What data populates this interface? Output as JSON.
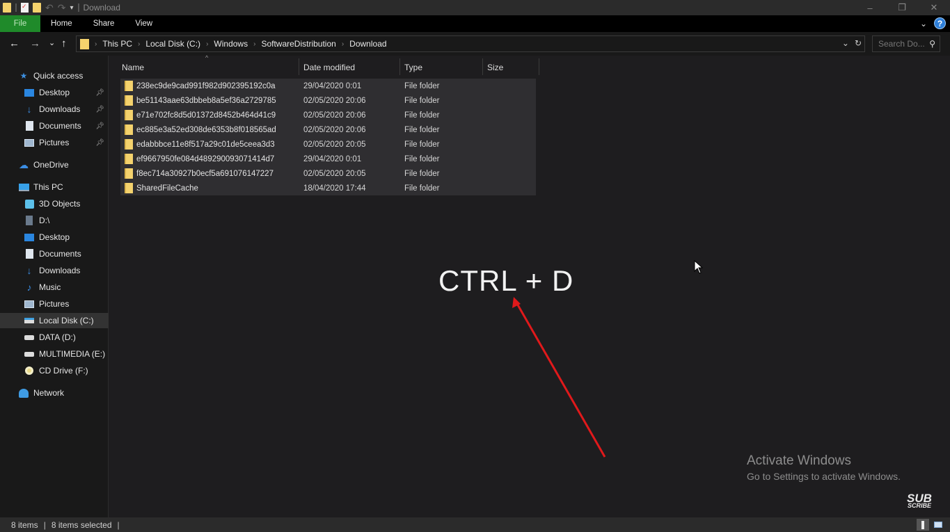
{
  "window": {
    "title": "Download",
    "controls": {
      "minimize": "–",
      "restore": "❐",
      "close": "✕"
    }
  },
  "quick_access_toolbar": {
    "icons": [
      "folder-icon",
      "properties-icon",
      "new-folder-icon",
      "undo-icon",
      "redo-icon",
      "customize-dropdown-icon"
    ]
  },
  "ribbon": {
    "tabs": [
      {
        "label": "File",
        "active": true
      },
      {
        "label": "Home"
      },
      {
        "label": "Share"
      },
      {
        "label": "View"
      }
    ],
    "help_label": "?"
  },
  "navigation": {
    "back": "←",
    "forward": "→",
    "recent": "⌄",
    "up": "↑",
    "breadcrumb": [
      "This PC",
      "Local Disk (C:)",
      "Windows",
      "SoftwareDistribution",
      "Download"
    ],
    "search_placeholder": "Search Do..."
  },
  "sidebar": {
    "items": [
      {
        "label": "Quick access",
        "icon": "star-icon",
        "level": 0
      },
      {
        "label": "Desktop",
        "icon": "desktop-icon",
        "level": 1,
        "pinned": true
      },
      {
        "label": "Downloads",
        "icon": "download-icon",
        "level": 1,
        "pinned": true
      },
      {
        "label": "Documents",
        "icon": "documents-icon",
        "level": 1,
        "pinned": true
      },
      {
        "label": "Pictures",
        "icon": "pictures-icon",
        "level": 1,
        "pinned": true
      },
      {
        "label": "OneDrive",
        "icon": "cloud-icon",
        "level": 0
      },
      {
        "label": "This PC",
        "icon": "computer-icon",
        "level": 0
      },
      {
        "label": "3D Objects",
        "icon": "cube-icon",
        "level": 1
      },
      {
        "label": "D:\\",
        "icon": "drive-icon",
        "level": 1
      },
      {
        "label": "Desktop",
        "icon": "desktop-icon",
        "level": 1
      },
      {
        "label": "Documents",
        "icon": "documents-icon",
        "level": 1
      },
      {
        "label": "Downloads",
        "icon": "download-icon",
        "level": 1
      },
      {
        "label": "Music",
        "icon": "music-icon",
        "level": 1
      },
      {
        "label": "Pictures",
        "icon": "pictures-icon",
        "level": 1
      },
      {
        "label": "Local Disk (C:)",
        "icon": "system-drive-icon",
        "level": 1,
        "selected": true
      },
      {
        "label": "DATA (D:)",
        "icon": "drive-icon",
        "level": 1
      },
      {
        "label": "MULTIMEDIA (E:)",
        "icon": "drive-icon",
        "level": 1
      },
      {
        "label": "CD Drive (F:)",
        "icon": "cd-icon",
        "level": 1
      },
      {
        "label": "Network",
        "icon": "network-icon",
        "level": 0
      }
    ]
  },
  "file_list": {
    "columns": [
      "Name",
      "Date modified",
      "Type",
      "Size"
    ],
    "rows": [
      {
        "name": "238ec9de9cad991f982d902395192c0a",
        "date": "29/04/2020 0:01",
        "type": "File folder",
        "size": ""
      },
      {
        "name": "be51143aae63dbbeb8a5ef36a2729785",
        "date": "02/05/2020 20:06",
        "type": "File folder",
        "size": ""
      },
      {
        "name": "e71e702fc8d5d01372d8452b464d41c9",
        "date": "02/05/2020 20:06",
        "type": "File folder",
        "size": ""
      },
      {
        "name": "ec885e3a52ed308de6353b8f018565ad",
        "date": "02/05/2020 20:06",
        "type": "File folder",
        "size": ""
      },
      {
        "name": "edabbbce11e8f517a29c01de5ceea3d3",
        "date": "02/05/2020 20:05",
        "type": "File folder",
        "size": ""
      },
      {
        "name": "ef9667950fe084d489290093071414d7",
        "date": "29/04/2020 0:01",
        "type": "File folder",
        "size": ""
      },
      {
        "name": "f8ec714a30927b0ecf5a691076147227",
        "date": "02/05/2020 20:05",
        "type": "File folder",
        "size": ""
      },
      {
        "name": "SharedFileCache",
        "date": "18/04/2020 17:44",
        "type": "File folder",
        "size": ""
      }
    ]
  },
  "annotation": {
    "text": "CTRL + D",
    "arrow_color": "#e0191b"
  },
  "watermark": {
    "title": "Activate Windows",
    "subtitle": "Go to Settings to activate Windows.",
    "subscribe_top": "SUB",
    "subscribe_bottom": "SCRIBE"
  },
  "status": {
    "items_count": "8 items",
    "selected_count": "8 items selected"
  },
  "colors": {
    "file_tab": "#1f8a2a",
    "folder": "#f4d26d",
    "selection": "#2f2e31",
    "background": "#1e1d1f"
  }
}
